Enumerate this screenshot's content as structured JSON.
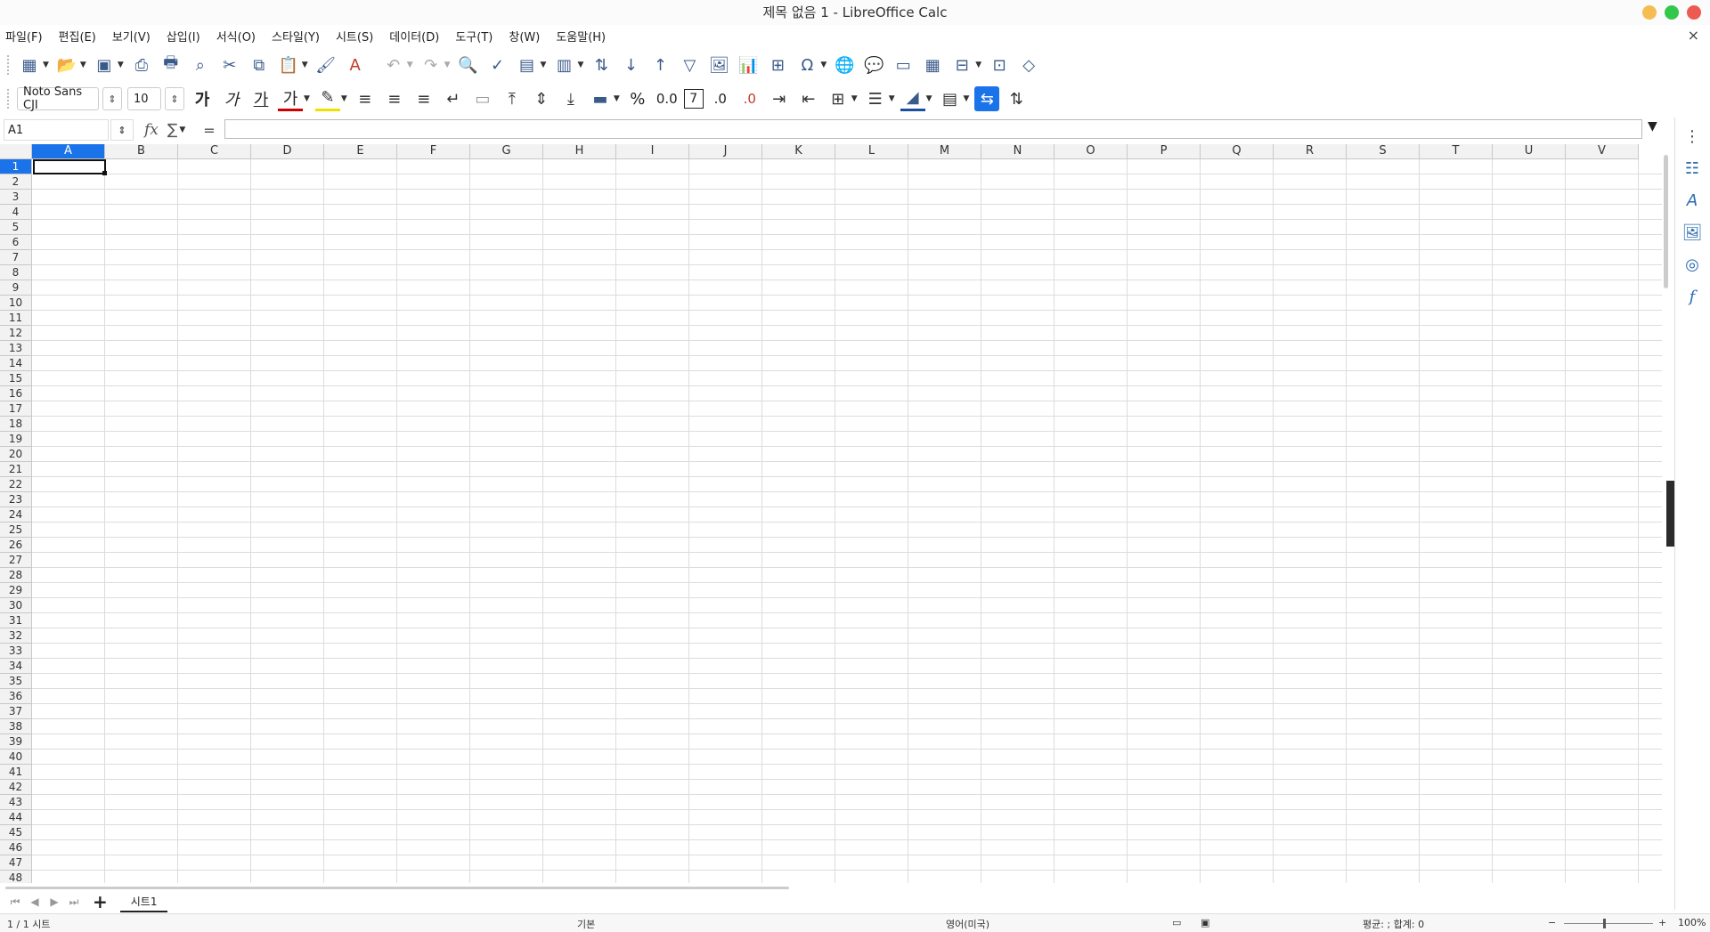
{
  "window": {
    "title": "제목 없음 1 - LibreOffice Calc",
    "colors": {
      "min": "#f5bd4f",
      "max": "#34c84a",
      "close": "#ed5a52"
    }
  },
  "menu": [
    "파일(F)",
    "편집(E)",
    "보기(V)",
    "삽입(I)",
    "서식(O)",
    "스타일(Y)",
    "시트(S)",
    "데이터(D)",
    "도구(T)",
    "창(W)",
    "도움말(H)"
  ],
  "menu_close": "×",
  "toolbar2": {
    "font_name": "Noto Sans CJI",
    "font_size": "10",
    "bold": "가",
    "italic": "가",
    "underline": "가",
    "font_color": "가",
    "percent": "%",
    "decimal": "0.0",
    "text_icon": "7",
    "add_decimal": ".0",
    "del_decimal": ".0"
  },
  "formula": {
    "cell_ref": "A1",
    "fx": "fx",
    "sum": "∑",
    "equals": "="
  },
  "columns": [
    "A",
    "B",
    "C",
    "D",
    "E",
    "F",
    "G",
    "H",
    "I",
    "J",
    "K",
    "L",
    "M",
    "N",
    "O",
    "P",
    "Q",
    "R",
    "S",
    "T",
    "U",
    "V"
  ],
  "rows": [
    "1",
    "2",
    "3",
    "4",
    "5",
    "6",
    "7",
    "8",
    "9",
    "10",
    "11",
    "12",
    "13",
    "14",
    "15",
    "16",
    "17",
    "18",
    "19",
    "20",
    "21",
    "22",
    "23",
    "24",
    "25",
    "26",
    "27",
    "28",
    "29",
    "30",
    "31",
    "32",
    "33",
    "34",
    "35",
    "36",
    "37",
    "38",
    "39",
    "40",
    "41",
    "42",
    "43",
    "44",
    "45",
    "46",
    "47",
    "48"
  ],
  "selected": {
    "column": "A",
    "row": "1"
  },
  "sheets": {
    "tab": "시트1",
    "add": "+"
  },
  "status": {
    "sheet_count": "1 / 1 시트",
    "style": "기본",
    "language": "영어(미국)",
    "summary": "평균: ; 합계: 0",
    "zoom": "100%"
  },
  "accent": "#1a73e8"
}
